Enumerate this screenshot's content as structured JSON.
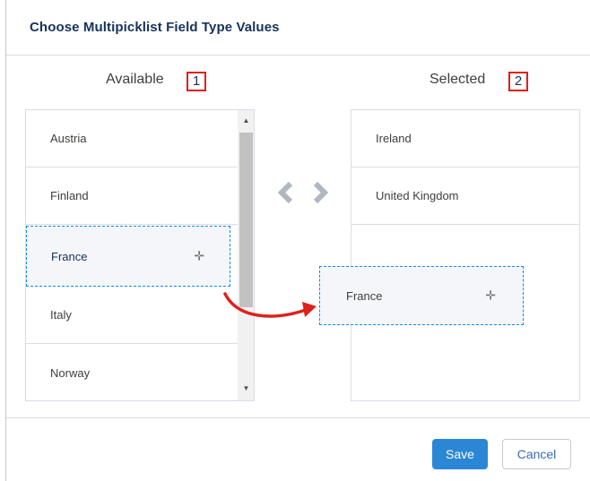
{
  "dialog": {
    "title": "Choose Multipicklist Field Type Values"
  },
  "available": {
    "title": "Available",
    "badge": "1",
    "items": [
      "Austria",
      "Finland",
      "France",
      "Italy",
      "Norway"
    ],
    "selected_item": "France"
  },
  "selected": {
    "title": "Selected",
    "badge": "2",
    "items": [
      "Ireland",
      "United Kingdom"
    ]
  },
  "drag": {
    "label": "France",
    "icon": "move-plus-icon"
  },
  "icons": {
    "left": "chevron-left-icon",
    "right": "chevron-right-icon",
    "scroll_up": "scroll-up-arrow-icon",
    "scroll_down": "scroll-down-arrow-icon",
    "drag_plus": "move-plus-icon",
    "drag_arrow": "curved-arrow-icon"
  },
  "colors": {
    "primary": "#2b87d5",
    "annotation_red": "#e0201b",
    "drag_border": "#1589ee",
    "chevron": "#b0b7c1"
  },
  "footer": {
    "save_label": "Save",
    "cancel_label": "Cancel"
  }
}
